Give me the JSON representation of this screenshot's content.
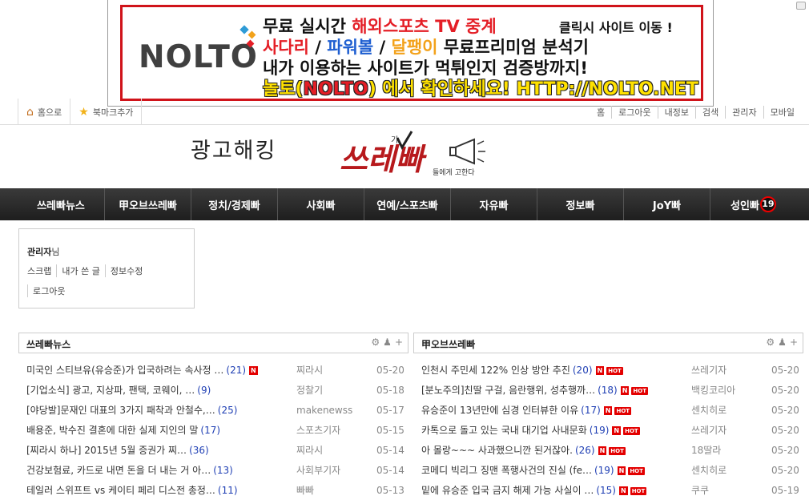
{
  "banner": {
    "logo": "NOLTO",
    "line1_a": "무료 실시간 ",
    "line1_b": "해외스포츠 TV 중계",
    "line1_right": "클릭시 사이트 이동 !",
    "line2_a": "사다리",
    "line2_sep1": " / ",
    "line2_b": "파워볼",
    "line2_sep2": " / ",
    "line2_c": "달팽이",
    "line2_d": " 무료프리미엄 분석기",
    "line3": "내가 이용하는 사이트가 먹튀인지 검증방까지!",
    "line4_a": "놀토(",
    "line4_b": "NOLTO",
    "line4_c": ") 에서 확인하세요! HTTP://NOLTO.NET"
  },
  "topbar": {
    "home": "홈으로",
    "bookmark": "북마크추가",
    "right": [
      "홈",
      "로그아웃",
      "내정보",
      "검색",
      "관리자",
      "모바일"
    ]
  },
  "site": {
    "ad_hack": "광고해킹",
    "logo_main": "쓰레빠",
    "logo_sub": "들에게 고한다",
    "logo_small": "기"
  },
  "nav": [
    "쓰레빠뉴스",
    "甲오브쓰레빠",
    "정치/경제빠",
    "사회빠",
    "연예/스포츠빠",
    "자유빠",
    "정보빠",
    "JoY빠",
    "성인빠"
  ],
  "nav_badge": "19",
  "login": {
    "user": "관리자",
    "user_suffix": "님",
    "links": [
      "스크랩",
      "내가 쓴 글",
      "정보수정"
    ],
    "logout": "로그아웃"
  },
  "boards": [
    {
      "title": "쓰레빠뉴스",
      "rows": [
        {
          "title": "미국인 스티브유(유승준)가 입국하려는 속사정 …",
          "comments": "(21)",
          "n": true,
          "hot": false,
          "author": "찌라시",
          "date": "05-20"
        },
        {
          "title": "[기업소식] 광고, 지상파, 팬택, 코웨이, …",
          "comments": "(9)",
          "n": false,
          "hot": false,
          "author": "정찰기",
          "date": "05-18"
        },
        {
          "title": "[야당발]문재인 대표의 3가지 패착과 안철수,…",
          "comments": "(25)",
          "n": false,
          "hot": false,
          "author": "makenewss",
          "date": "05-17"
        },
        {
          "title": "배용준, 박수진 결혼에 대한 실제 지인의 말",
          "comments": "(17)",
          "n": false,
          "hot": false,
          "author": "스포츠기자",
          "date": "05-15"
        },
        {
          "title": "[찌라시 하나] 2015년 5월 증권가 찌…",
          "comments": "(36)",
          "n": false,
          "hot": false,
          "author": "찌라시",
          "date": "05-14"
        },
        {
          "title": "건강보험료, 카드로 내면 돈을 더 내는 거 아…",
          "comments": "(13)",
          "n": false,
          "hot": false,
          "author": "사회부기자",
          "date": "05-14"
        },
        {
          "title": "테일러 스위프트 vs 케이티 페리 디스전 총정…",
          "comments": "(11)",
          "n": false,
          "hot": false,
          "author": "빠빠",
          "date": "05-13"
        }
      ]
    },
    {
      "title": "甲오브쓰레빠",
      "rows": [
        {
          "title": "인천시 주민세 122% 인상 방안 추진",
          "comments": "(20)",
          "n": true,
          "hot": true,
          "author": "쓰레기자",
          "date": "05-20"
        },
        {
          "title": "[분노주의]친딸 구걸, 음란행위, 성추행까…",
          "comments": "(18)",
          "n": true,
          "hot": true,
          "author": "백킹코리아",
          "date": "05-20"
        },
        {
          "title": "유승준이 13년만에 심경 인터뷰한 이유",
          "comments": "(17)",
          "n": true,
          "hot": true,
          "author": "센치히로",
          "date": "05-20"
        },
        {
          "title": "카톡으로 돌고 있는 국내 대기업 사내문화",
          "comments": "(19)",
          "n": true,
          "hot": true,
          "author": "쓰레기자",
          "date": "05-20"
        },
        {
          "title": "아 몰랑~~~ 사과했으니깐 된거잖아.",
          "comments": "(26)",
          "n": true,
          "hot": true,
          "author": "18딸라",
          "date": "05-20"
        },
        {
          "title": "코메디 빅리그 징맨 폭행사건의 진실 (fe…",
          "comments": "(19)",
          "n": true,
          "hot": true,
          "author": "센치히로",
          "date": "05-20"
        },
        {
          "title": "밑에 유승준 입국 금지 해제 가능 사실이 …",
          "comments": "(15)",
          "n": true,
          "hot": true,
          "author": "쿠쿠",
          "date": "05-19"
        }
      ]
    }
  ],
  "badges": {
    "n": "N",
    "hot": "HOT"
  }
}
